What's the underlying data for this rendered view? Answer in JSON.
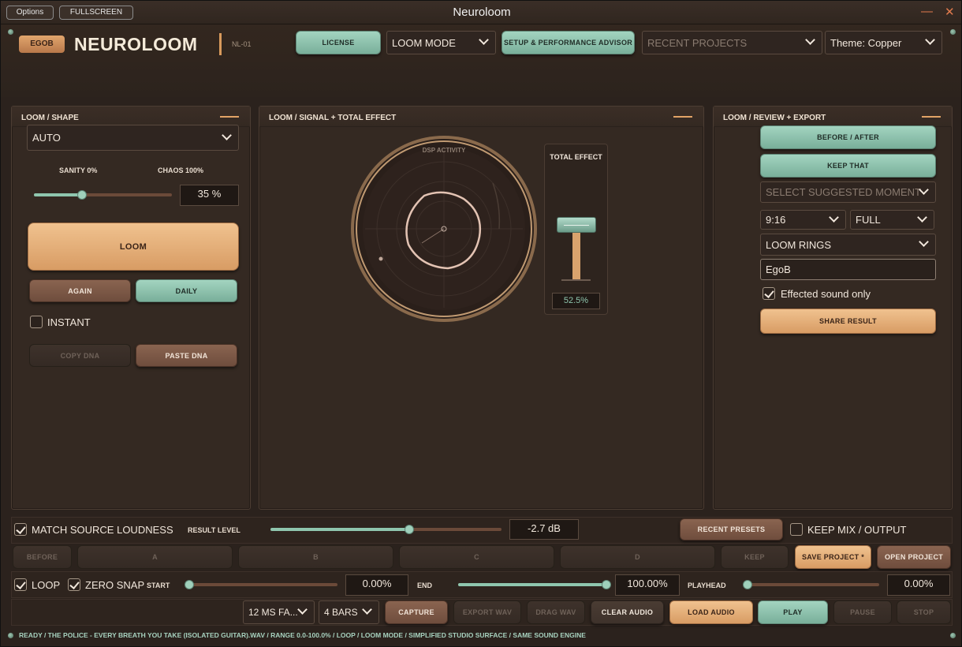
{
  "window": {
    "title": "Neuroloom",
    "options_label": "Options",
    "fullscreen_label": "FULLSCREEN",
    "minimize_glyph": "—",
    "close_glyph": "✕"
  },
  "header": {
    "badge": "EGOB",
    "brand": "NEUROLOOM",
    "model": "NL-01",
    "license_label": "LICENSE",
    "mode_select": "LOOM MODE",
    "advisor_label": "SETUP & PERFORMANCE ADVISOR",
    "recent_projects": "RECENT PROJECTS",
    "theme": "Theme: Copper"
  },
  "shape_panel": {
    "title": "LOOM  /  SHAPE",
    "mode": "AUTO",
    "sanity_label": "SANITY 0%",
    "chaos_label": "CHAOS 100%",
    "chaos_value": 35,
    "chaos_text": "35 %",
    "loom_label": "LOOM",
    "again_label": "AGAIN",
    "daily_label": "DAILY",
    "instant_label": "INSTANT",
    "instant_checked": false,
    "copy_dna_label": "COPY DNA",
    "paste_dna_label": "PASTE DNA"
  },
  "signal_panel": {
    "title": "LOOM  /  SIGNAL + TOTAL EFFECT",
    "dsp_label": "DSP ACTIVITY",
    "total_effect_label": "TOTAL EFFECT",
    "total_effect_value": 52.5,
    "total_effect_text": "52.5%"
  },
  "review_panel": {
    "title": "LOOM  /  REVIEW + EXPORT",
    "before_after_label": "BEFORE / AFTER",
    "keep_that_label": "KEEP THAT",
    "moment_select": "SELECT SUGGESTED MOMENT",
    "aspect_select": "9:16",
    "size_select": "FULL",
    "visual_select": "LOOM RINGS",
    "name_value": "EgoB",
    "effected_only_label": "Effected sound only",
    "effected_only_checked": true,
    "share_label": "SHARE RESULT"
  },
  "mix_bar": {
    "match_loudness_label": "MATCH SOURCE LOUDNESS",
    "match_loudness_checked": true,
    "result_level_label": "RESULT LEVEL",
    "result_level_fraction": 0.6,
    "result_level_text": "-2.7 dB",
    "recent_presets_label": "RECENT PRESETS",
    "keep_mix_label": "KEEP MIX / OUTPUT",
    "keep_mix_checked": false
  },
  "slots_bar": {
    "before_label": "BEFORE",
    "a_label": "A",
    "b_label": "B",
    "c_label": "C",
    "d_label": "D",
    "keep_label": "KEEP",
    "save_label": "SAVE PROJECT *",
    "open_label": "OPEN PROJECT"
  },
  "range_bar": {
    "loop_label": "LOOP",
    "loop_checked": true,
    "zero_snap_label": "ZERO SNAP",
    "zero_snap_checked": true,
    "start_label": "START",
    "start_fraction": 0.0,
    "start_text": "0.00%",
    "end_label": "END",
    "end_fraction": 1.0,
    "end_text": "100.00%",
    "playhead_label": "PLAYHEAD",
    "playhead_fraction": 0.0,
    "playhead_text": "0.00%"
  },
  "transport_bar": {
    "fade_select": "12 MS FA...",
    "bars_select": "4 BARS",
    "capture_label": "CAPTURE",
    "export_wav_label": "EXPORT WAV",
    "drag_wav_label": "DRAG WAV",
    "clear_audio_label": "CLEAR AUDIO",
    "load_audio_label": "LOAD AUDIO",
    "play_label": "PLAY",
    "pause_label": "PAUSE",
    "stop_label": "STOP"
  },
  "status": {
    "text": "READY  /  THE POLICE - EVERY BREATH YOU TAKE (ISOLATED GUITAR).WAV  /  RANGE 0.0-100.0%  /  LOOP  /  LOOM MODE / SIMPLIFIED STUDIO SURFACE / SAME SOUND ENGINE"
  },
  "colors": {
    "accent_teal": "#8fc6ae",
    "accent_copper": "#e2a366",
    "background": "#2b221d"
  }
}
